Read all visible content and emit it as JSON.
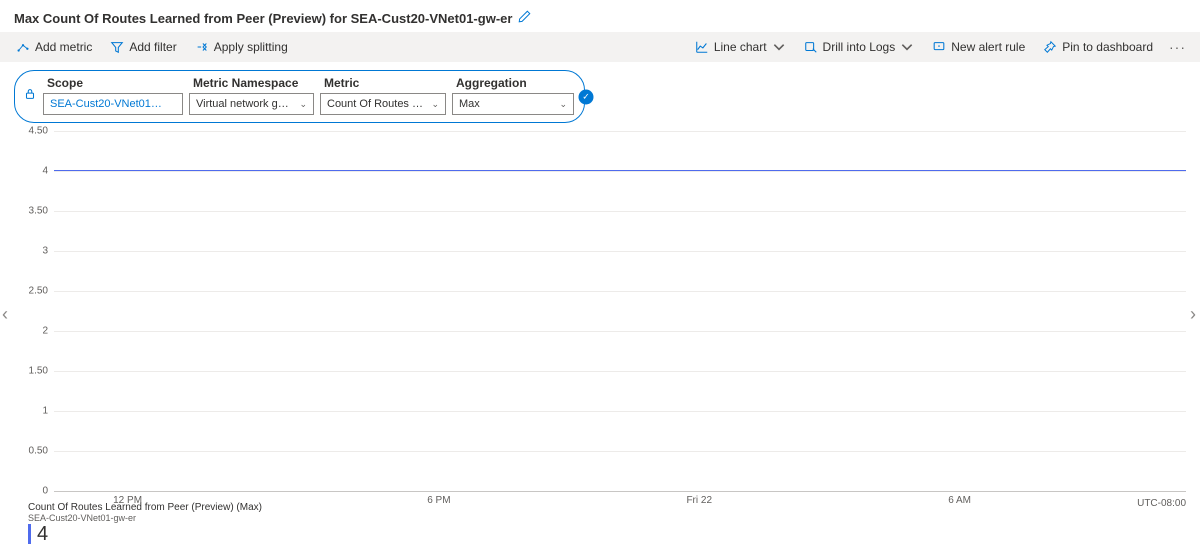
{
  "header": {
    "title": "Max Count Of Routes Learned from Peer (Preview) for SEA-Cust20-VNet01-gw-er"
  },
  "toolbar": {
    "add_metric": "Add metric",
    "add_filter": "Add filter",
    "apply_splitting": "Apply splitting",
    "line_chart": "Line chart",
    "drill_logs": "Drill into Logs",
    "new_alert": "New alert rule",
    "pin": "Pin to dashboard"
  },
  "selectors": {
    "scope_label": "Scope",
    "scope_value": "SEA-Cust20-VNet01-gw-er",
    "ns_label": "Metric Namespace",
    "ns_value": "Virtual network gatewa...",
    "metric_label": "Metric",
    "metric_value": "Count Of Routes Learne...",
    "agg_label": "Aggregation",
    "agg_value": "Max"
  },
  "chart_data": {
    "type": "line",
    "y_ticks": [
      "4.50",
      "4",
      "3.50",
      "3",
      "2.50",
      "2",
      "1.50",
      "1",
      "0.50",
      "0"
    ],
    "ylim": [
      0,
      4.5
    ],
    "x_ticks": [
      {
        "label": "12 PM",
        "pos_pct": 6.5
      },
      {
        "label": "6 PM",
        "pos_pct": 34
      },
      {
        "label": "Fri 22",
        "pos_pct": 57
      },
      {
        "label": "6 AM",
        "pos_pct": 80
      }
    ],
    "series": [
      {
        "name": "Count Of Routes Learned from Peer (Preview) (Max)",
        "value_constant": 4
      }
    ],
    "timezone": "UTC-08:00"
  },
  "legend": {
    "series": "Count Of Routes Learned from Peer (Preview) (Max)",
    "resource": "SEA-Cust20-VNet01-gw-er",
    "value": "4"
  }
}
